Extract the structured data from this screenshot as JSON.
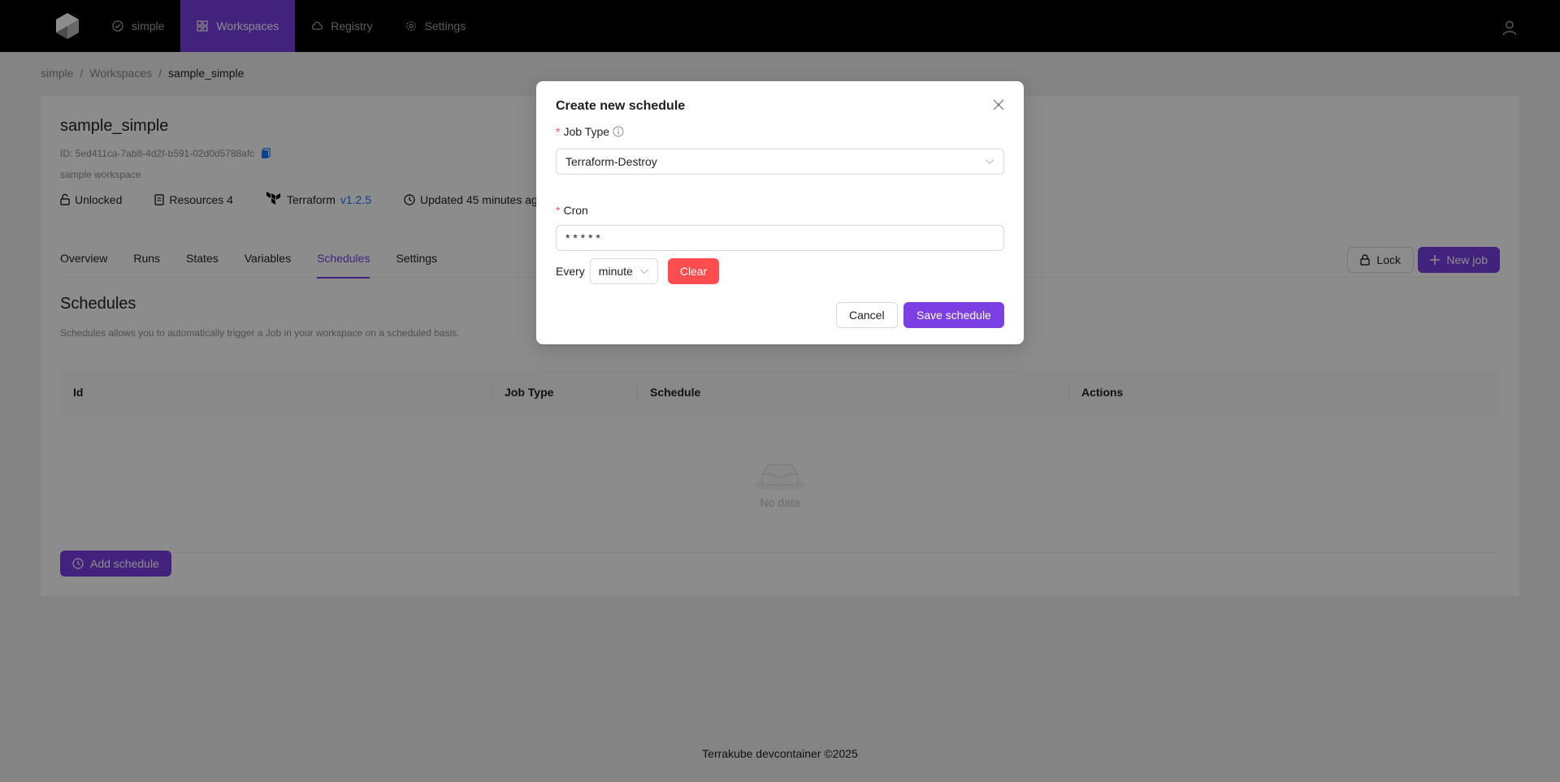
{
  "nav": {
    "logo_icon": "terrakube-logo-icon",
    "items": [
      {
        "label": "simple",
        "icon": "check-circle-icon"
      },
      {
        "label": "Workspaces",
        "icon": "grid-icon",
        "active": true
      },
      {
        "label": "Registry",
        "icon": "cloud-icon"
      },
      {
        "label": "Settings",
        "icon": "gear-icon"
      }
    ],
    "user_icon": "user-icon"
  },
  "breadcrumb": [
    "simple",
    "Workspaces",
    "sample_simple"
  ],
  "breadcrumb_sep": "/",
  "workspace": {
    "title": "sample_simple",
    "id": "ID: 5ed411ca-7ab8-4d2f-b591-02d0d5788afc",
    "description": "sample workspace",
    "lock_state": "Unlocked",
    "resources": "Resources 4",
    "tool": "Terraform",
    "version": "v1.2.5",
    "updated": "Updated 45 minutes ago"
  },
  "tabs": [
    "Overview",
    "Runs",
    "States",
    "Variables",
    "Schedules",
    "Settings"
  ],
  "active_tab": "Schedules",
  "actions": {
    "lock": "Lock",
    "new_job": "New job"
  },
  "schedules": {
    "title": "Schedules",
    "description": "Schedules allows you to automatically trigger a Job in your workspace on a scheduled basis.",
    "columns": [
      "Id",
      "Job Type",
      "Schedule",
      "Actions"
    ],
    "empty_text": "No data",
    "add_button": "Add schedule"
  },
  "footer": "Terrakube devcontainer ©2025",
  "modal": {
    "title": "Create new schedule",
    "job_type_label": "Job Type",
    "job_type_value": "Terraform-Destroy",
    "cron_label": "Cron",
    "cron_value": "* * * * *",
    "every_label": "Every",
    "every_value": "minute",
    "clear_button": "Clear",
    "cancel_button": "Cancel",
    "save_button": "Save schedule"
  },
  "colors": {
    "primary": "#7b3fe4",
    "danger": "#ff4d4f",
    "nav_bg": "#000000"
  }
}
